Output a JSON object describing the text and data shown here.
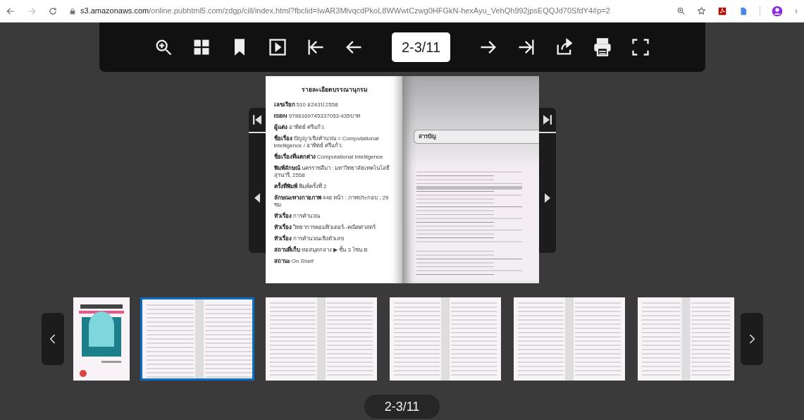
{
  "browser": {
    "url": "s3.amazonaws.com/online.pubhtml5.com/zdgp/cill/index.html?fbclid=IwAR3MlvqcdPkoL8WWwtCzwg0HFGkN-hexAyu_VehQh992jpsEQQJd70SfdY4#p=2"
  },
  "toolbar": {
    "page_indicator": "2-3/11"
  },
  "left_page": {
    "title": "รายละเอียดบรรณานุกรม",
    "fields": [
      {
        "label": "เลขเรียก",
        "value": "510 อ243ป 2558"
      },
      {
        "label": "ISBN",
        "value": "9786169745337053:435บาท"
      },
      {
        "label": "ผู้แต่ง",
        "value": "อาทิตย์ ศรีแก้ว."
      },
      {
        "label": "ชื่อเรื่อง",
        "value": "ปัญญาเชิงคำนวณ = Computational intelligence / อาทิตย์ ศรีแก้ว."
      },
      {
        "label": "ชื่อเรื่องที่แตกต่าง",
        "value": "Computational intelligence"
      },
      {
        "label": "พิมพ์ลักษณ์",
        "value": "นครราชสีมา : มหาวิทยาลัยเทคโนโลยีสุรนารี, 2558"
      },
      {
        "label": "ครั้งที่พิมพ์",
        "value": "พิมพ์ครั้งที่ 2"
      },
      {
        "label": "ลักษณะทางกายภาพ",
        "value": "448 หน้า : ภาพประกอบ ; 29 ซม"
      },
      {
        "label": "หัวเรื่อง",
        "value": "การคำนวณ"
      },
      {
        "label": "หัวเรื่อง",
        "value": "วิทยาการคอมพิวเตอร์--คณิตศาสตร์"
      },
      {
        "label": "หัวเรื่อง",
        "value": "การคำนวณเชิงตัวเลข"
      },
      {
        "label": "สถานที่เก็บ",
        "value": "หอสมุดกลาง ▶ ชั้น 3 โซน B"
      },
      {
        "label": "สถานะ",
        "value": "On Shelf"
      }
    ]
  },
  "right_page": {
    "heading": "สารบัญ"
  },
  "thumbnails": [
    {
      "kind": "cover",
      "selected": false
    },
    {
      "kind": "spread",
      "selected": true
    },
    {
      "kind": "spread",
      "selected": false
    },
    {
      "kind": "spread",
      "selected": false
    },
    {
      "kind": "spread",
      "selected": false
    },
    {
      "kind": "spread",
      "selected": false
    }
  ],
  "page_counter": "2-3/11"
}
